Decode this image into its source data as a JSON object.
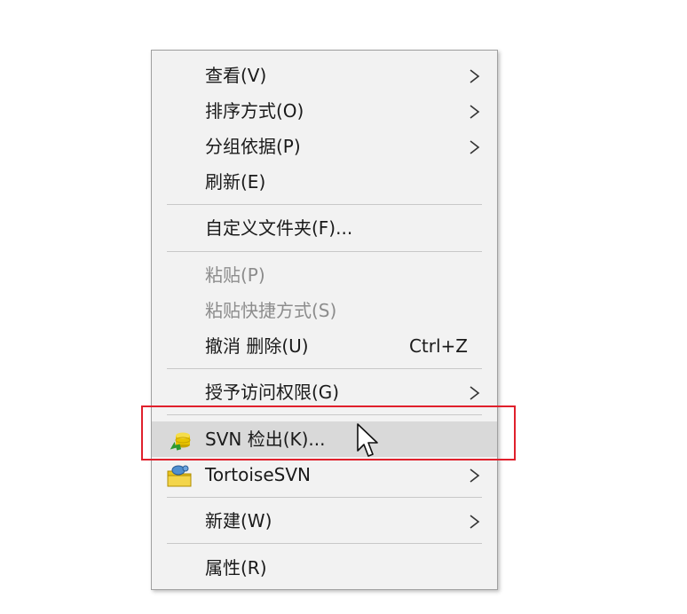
{
  "context_menu": {
    "view": "查看(V)",
    "sort_by": "排序方式(O)",
    "group_by": "分组依据(P)",
    "refresh": "刷新(E)",
    "customize_folder": "自定义文件夹(F)...",
    "paste": "粘贴(P)",
    "paste_shortcut": "粘贴快捷方式(S)",
    "undo_delete": "撤消 删除(U)",
    "undo_shortcut": "Ctrl+Z",
    "grant_access": "授予访问权限(G)",
    "svn_checkout": "SVN 检出(K)...",
    "tortoisesvn": "TortoiseSVN",
    "new": "新建(W)",
    "properties": "属性(R)"
  },
  "icons": {
    "submenu_arrow": "chevron-right-icon",
    "svn_checkout": "svn-checkout-icon",
    "tortoisesvn": "tortoisesvn-icon",
    "cursor": "mouse-pointer-icon"
  },
  "colors": {
    "menu_bg": "#f2f2f2",
    "hover_bg": "#d9d9d9",
    "disabled_text": "#8c8c8c",
    "highlight_border": "#e0202c"
  }
}
